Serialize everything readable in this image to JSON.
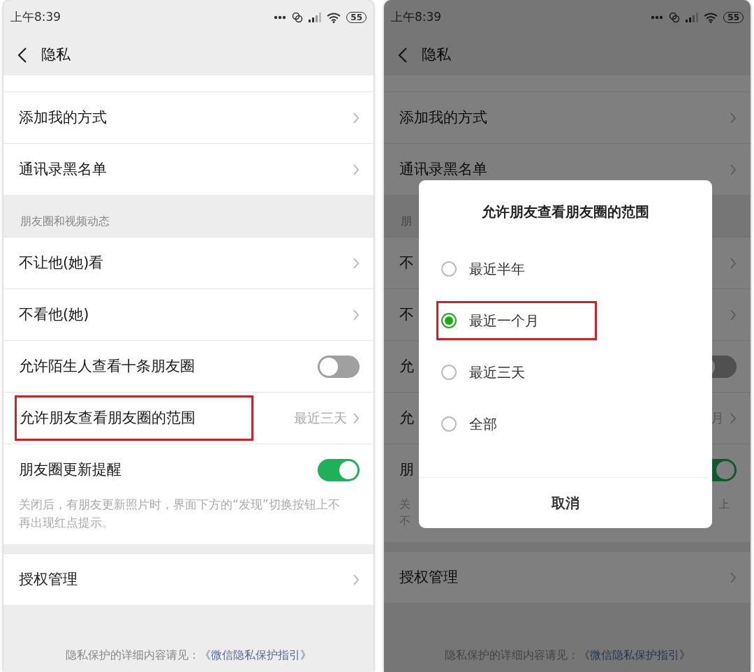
{
  "screens": [
    {
      "status_bar": {
        "time": "上午8:39",
        "battery": "55"
      },
      "header": {
        "title": "隐私"
      },
      "sections": [
        {
          "rows": [
            {
              "kind": "link",
              "label": "添加我的方式"
            },
            {
              "kind": "link",
              "label": "通讯录黑名单"
            }
          ]
        },
        {
          "title": "朋友圈和视频动态",
          "rows": [
            {
              "kind": "link",
              "label": "不让他(她)看"
            },
            {
              "kind": "link",
              "label": "不看他(她)"
            },
            {
              "kind": "toggle",
              "label": "允许陌生人查看十条朋友圈",
              "on": false
            },
            {
              "kind": "link",
              "label": "允许朋友查看朋友圈的范围",
              "value": "最近三天",
              "highlighted": true
            },
            {
              "kind": "toggle",
              "label": "朋友圈更新提醒",
              "on": true,
              "description": "关闭后，有朋友更新照片时，界面下方的“发现”切换按钮上不再出现红点提示。"
            }
          ]
        },
        {
          "rows": [
            {
              "kind": "link",
              "label": "授权管理"
            }
          ]
        }
      ],
      "footer": {
        "text": "隐私保护的详细内容请见：",
        "link": "《微信隐私保护指引》"
      }
    },
    {
      "status_bar": {
        "time": "上午8:39",
        "battery": "55"
      },
      "header": {
        "title": "隐私"
      },
      "sections": [
        {
          "rows": [
            {
              "kind": "link",
              "label": "添加我的方式"
            },
            {
              "kind": "link",
              "label": "通讯录黑名单"
            }
          ]
        },
        {
          "title": "朋",
          "rows": [
            {
              "kind": "link",
              "label": "不"
            },
            {
              "kind": "link",
              "label": "不"
            },
            {
              "kind": "toggle",
              "label": "允",
              "on": false
            },
            {
              "kind": "link",
              "label": "允",
              "value": "月"
            },
            {
              "kind": "toggle",
              "label": "朋",
              "on": true,
              "description_lines": [
                {
                  "left": "关",
                  "right": "上"
                },
                {
                  "left": "不"
                }
              ]
            }
          ]
        },
        {
          "rows": [
            {
              "kind": "link",
              "label": "授权管理"
            }
          ]
        }
      ],
      "footer": {
        "text": "隐私保护的详细内容请见：",
        "link": "《微信隐私保护指引》"
      },
      "dialog": {
        "title": "允许朋友查看朋友圈的范围",
        "options": [
          {
            "label": "最近半年",
            "selected": false,
            "highlighted": false
          },
          {
            "label": "最近一个月",
            "selected": true,
            "highlighted": true
          },
          {
            "label": "最近三天",
            "selected": false,
            "highlighted": false
          },
          {
            "label": "全部",
            "selected": false,
            "highlighted": false
          }
        ],
        "cancel": "取消"
      }
    }
  ]
}
